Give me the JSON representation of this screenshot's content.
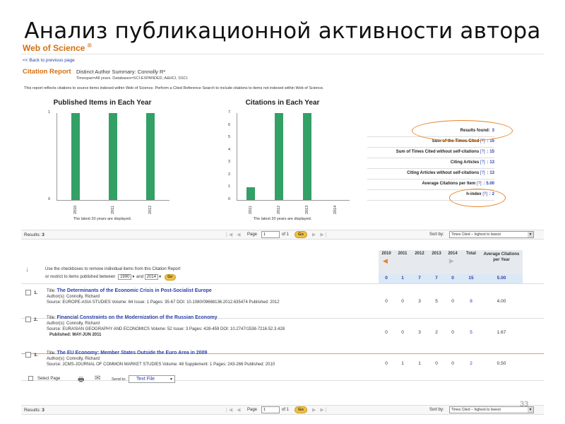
{
  "slide": {
    "title": "Анализ публикационной активности автора",
    "page_number": "33"
  },
  "header": {
    "logo": "Web of Science",
    "logo_mark": "®",
    "back_link": "<< Back to previous page",
    "report_title": "Citation Report",
    "report_subtitle": "Distinct Author Summary: Connolly R*",
    "timespan": "Timespan=All years. Databases=SCI-EXPANDED, A&HCI, SSCI.",
    "note": "This report reflects citations to source items indexed within Web of Science. Perform a Cited Reference Search to include citations to items not indexed within Web of Science."
  },
  "chart_data": [
    {
      "type": "bar",
      "title": "Published Items in Each Year",
      "categories": [
        "2010",
        "2011",
        "2012"
      ],
      "values": [
        1,
        1,
        1
      ],
      "ylim": [
        0,
        1
      ],
      "yticks": [
        "0",
        "1"
      ],
      "caption": "The latest 20 years are displayed.",
      "color": "#33a066"
    },
    {
      "type": "bar",
      "title": "Citations in Each Year",
      "categories": [
        "2011",
        "2012",
        "2013",
        "2014"
      ],
      "values": [
        1,
        7,
        7,
        0
      ],
      "ylim": [
        0,
        7
      ],
      "yticks": [
        "0",
        "1",
        "2",
        "3",
        "4",
        "5",
        "6",
        "7"
      ],
      "caption": "The latest 20 years are displayed.",
      "color": "#33a066"
    }
  ],
  "stats": [
    {
      "label": "Results found:",
      "help": "",
      "value": "3"
    },
    {
      "label": "Sum of the Times Cited",
      "help": "[?]",
      "value": ": 15"
    },
    {
      "label": "Sum of Times Cited without self-citations",
      "help": "[?]",
      "value": ": 15"
    },
    {
      "label": "Citing Articles",
      "help": "[?]",
      "value": ": 13"
    },
    {
      "label": "Citing Articles without self-citations",
      "help": "[?]",
      "value": ": 13"
    },
    {
      "label": "Average Citations per Item",
      "help": "[?]",
      "value": ": 5.00"
    },
    {
      "label": "h-index",
      "help": "[?]",
      "value": ": 2"
    }
  ],
  "pager": {
    "results_label": "Results:",
    "results_count": "3",
    "page_label": "Page",
    "page_value": "1",
    "of_label": "of 1",
    "go": "Go",
    "sort_label": "Sort by:",
    "sort_value": "Times Cited -- highest to lowest"
  },
  "table": {
    "instruction_1": "Use the checkboxes to remove individual items from this Citation Report",
    "instruction_2": "or restrict to items published between",
    "from_year": "1990",
    "and_label": "and",
    "to_year": "2014",
    "go": "Go",
    "years": [
      "2010",
      "2011",
      "2012",
      "2013",
      "2014"
    ],
    "total_label": "Total",
    "avg_label": "Average Citations per Year",
    "totals": [
      "0",
      "1",
      "7",
      "7",
      "0",
      "15",
      "5.00"
    ],
    "records": [
      {
        "number": "1.",
        "title_label": "Title:",
        "title": "The Determinants of the Economic Crisis in Post-Socialist Europe",
        "authors": "Author(s): Connolly, Richard",
        "source": "Source: EUROPE-ASIA STUDIES  Volume: 64  Issue: 1  Pages: 35-67  DOI: 10.1080/09668136.2012.635474  Published: 2012",
        "source_2": "",
        "cites": [
          "0",
          "0",
          "3",
          "5",
          "0"
        ],
        "total": "8",
        "avg": "4.00"
      },
      {
        "number": "2.",
        "title_label": "Title:",
        "title": "Financial Constraints on the Modernization of the Russian Economy",
        "authors": "Author(s): Connolly, Richard",
        "source": "Source: EURASIAN GEOGRAPHY AND ECONOMICS  Volume: 52  Issue: 3  Pages: 428-459  DOI: 10.2747/1538-7216.52.3.428",
        "source_2": "Published: MAY-JUN 2011",
        "cites": [
          "0",
          "0",
          "3",
          "2",
          "0"
        ],
        "total": "5",
        "avg": "1.67"
      },
      {
        "number": "3.",
        "title_label": "Title:",
        "title": "The EU Economy: Member States Outside the Euro Area in 2009",
        "authors": "Author(s): Connolly, Richard",
        "source": "Source: JCMS-JOURNAL OF COMMON MARKET STUDIES  Volume: 48  Supplement: 1  Pages: 243-266  Published: 2010",
        "source_2": "",
        "cites": [
          "0",
          "1",
          "1",
          "0",
          "0"
        ],
        "total": "2",
        "avg": "0.50"
      }
    ]
  },
  "footer_tools": {
    "select_page": "Select Page",
    "send_to": "Send to:",
    "send_target": "Text File"
  },
  "colors": {
    "accent": "#d56e0e",
    "link": "#2a3fa8",
    "bar": "#33a066",
    "highlight_ring": "#e8842a"
  }
}
